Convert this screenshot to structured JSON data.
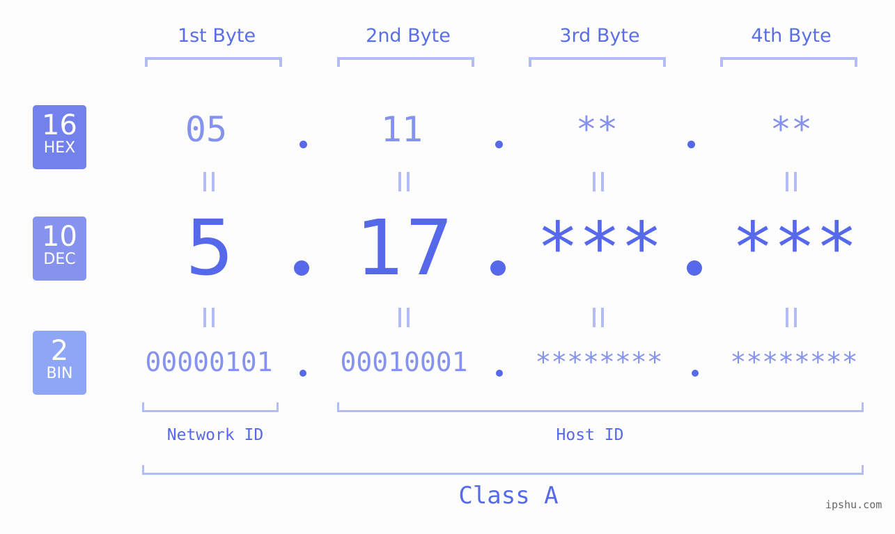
{
  "bytes": [
    {
      "label": "1st Byte",
      "hex": "05",
      "dec": "5",
      "bin": "00000101"
    },
    {
      "label": "2nd Byte",
      "hex": "11",
      "dec": "17",
      "bin": "00010001"
    },
    {
      "label": "3rd Byte",
      "hex": "**",
      "dec": "***",
      "bin": "********"
    },
    {
      "label": "4th Byte",
      "hex": "**",
      "dec": "***",
      "bin": "********"
    }
  ],
  "bases": {
    "hex": {
      "num": "16",
      "name": "HEX",
      "color": "#7381ec"
    },
    "dec": {
      "num": "10",
      "name": "DEC",
      "color": "#8593ef"
    },
    "bin": {
      "num": "2",
      "name": "BIN",
      "color": "#8fa6f6"
    }
  },
  "segments": {
    "network": "Network ID",
    "host": "Host ID"
  },
  "ip_class": "Class A",
  "watermark": "ipshu.com",
  "colors": {
    "accent": "#5669ea",
    "light_value": "#8593ee",
    "bracket": "#b3bcf6",
    "background": "#fcfdfc"
  }
}
